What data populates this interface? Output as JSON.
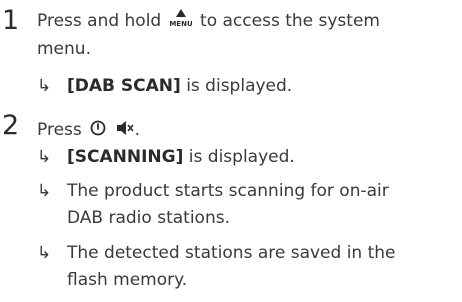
{
  "steps": [
    {
      "number": "1",
      "text_before": "Press and hold",
      "icon_label": "MENU",
      "text_after": "to access the system",
      "text_line2": "menu.",
      "results": [
        {
          "bold": "[DAB SCAN]",
          "rest": " is displayed."
        }
      ]
    },
    {
      "number": "2",
      "text_before": "Press",
      "text_after": ".",
      "results": [
        {
          "bold": "[SCANNING]",
          "rest": " is displayed."
        },
        {
          "line1": "The product starts scanning for on-air",
          "line2": "DAB radio stations."
        },
        {
          "line1": "The detected stations are saved in the",
          "line2": "flash memory."
        }
      ]
    }
  ],
  "arrow_glyph": "↳",
  "icons": [
    "menu-icon",
    "power-icon",
    "speaker-mute-icon"
  ]
}
